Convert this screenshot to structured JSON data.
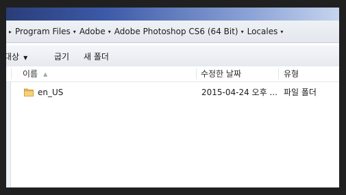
{
  "breadcrumb": {
    "items": [
      "Program Files",
      "Adobe",
      "Adobe Photoshop CS6 (64 Bit)",
      "Locales"
    ]
  },
  "toolbar": {
    "organize_label": "대상",
    "burn_label": "굽기",
    "new_folder_label": "새 폴더"
  },
  "columns": {
    "name": "이름",
    "modified": "수정한 날짜",
    "type": "유형"
  },
  "files": [
    {
      "name": "en_US",
      "modified": "2015-04-24 오후 ...",
      "type": "파일 폴더",
      "icon": "folder-icon"
    }
  ]
}
